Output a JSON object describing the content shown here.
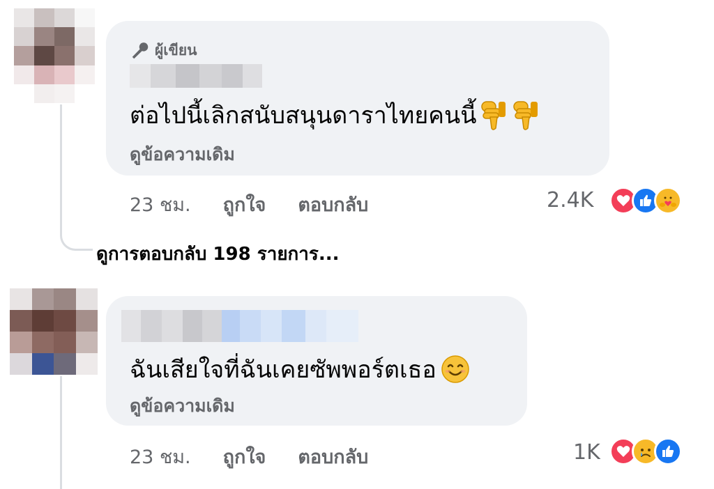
{
  "comments": [
    {
      "author_badge": "ผู้เขียน",
      "text": "ต่อไปนี้เลิกสนับสนุนดาราไทยคนนี้",
      "see_original": "ดูข้อความเดิม",
      "time": "23 ชม.",
      "like_label": "ถูกใจ",
      "reply_label": "ตอบกลับ",
      "reaction_count": "2.4K",
      "reactions": [
        "love-icon",
        "like-icon",
        "care-icon"
      ],
      "emoji": [
        "thumbs-down-icon",
        "thumbs-down-icon"
      ]
    },
    {
      "text": "ฉันเสียใจที่ฉันเคยซัพพอร์ตเธอ",
      "see_original": "ดูข้อความเดิม",
      "time": "23 ชม.",
      "like_label": "ถูกใจ",
      "reply_label": "ตอบกลับ",
      "reaction_count": "1K",
      "reactions": [
        "love-icon",
        "sad-icon",
        "like-icon"
      ],
      "emoji": [
        "smiling-face-icon"
      ]
    }
  ],
  "view_replies": "ดูการตอบกลับ 198 รายการ...",
  "colors": {
    "bubble": "#f0f2f5",
    "secondary_text": "#65676b",
    "love": "#f33e58",
    "like": "#1877f2",
    "emoji_yellow": "#f7b928"
  }
}
